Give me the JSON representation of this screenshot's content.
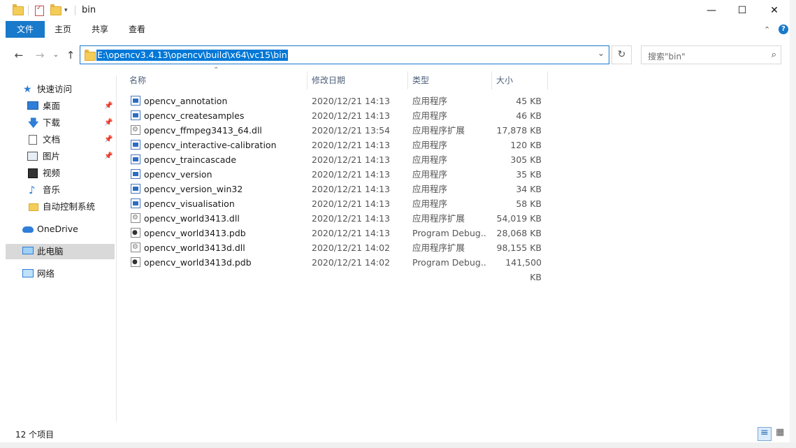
{
  "window": {
    "title": "bin",
    "controls": {
      "minimize": "—",
      "maximize": "☐",
      "close": "✕"
    }
  },
  "ribbon": {
    "tabs": [
      "文件",
      "主页",
      "共享",
      "查看"
    ]
  },
  "address": {
    "path": "E:\\opencv3.4.13\\opencv\\build\\x64\\vc15\\bin",
    "search_placeholder": "搜索\"bin\""
  },
  "nav": {
    "quick_access": "快速访问",
    "items": [
      {
        "label": "桌面",
        "icon": "desktop-icon",
        "pinned": true
      },
      {
        "label": "下载",
        "icon": "download-icon",
        "pinned": true
      },
      {
        "label": "文档",
        "icon": "documents-icon",
        "pinned": true
      },
      {
        "label": "图片",
        "icon": "pictures-icon",
        "pinned": true
      },
      {
        "label": "视频",
        "icon": "videos-icon",
        "pinned": false
      },
      {
        "label": "音乐",
        "icon": "music-icon",
        "pinned": false
      },
      {
        "label": "自动控制系统",
        "icon": "folder-icon",
        "pinned": false
      }
    ],
    "onedrive": "OneDrive",
    "this_pc": "此电脑",
    "network": "网络"
  },
  "columns": {
    "name": "名称",
    "date": "修改日期",
    "type": "类型",
    "size": "大小"
  },
  "files": [
    {
      "name": "opencv_annotation",
      "date": "2020/12/21 14:13",
      "type": "应用程序",
      "size": "45 KB",
      "kind": "exe"
    },
    {
      "name": "opencv_createsamples",
      "date": "2020/12/21 14:13",
      "type": "应用程序",
      "size": "46 KB",
      "kind": "exe"
    },
    {
      "name": "opencv_ffmpeg3413_64.dll",
      "date": "2020/12/21 13:54",
      "type": "应用程序扩展",
      "size": "17,878 KB",
      "kind": "dll"
    },
    {
      "name": "opencv_interactive-calibration",
      "date": "2020/12/21 14:13",
      "type": "应用程序",
      "size": "120 KB",
      "kind": "exe"
    },
    {
      "name": "opencv_traincascade",
      "date": "2020/12/21 14:13",
      "type": "应用程序",
      "size": "305 KB",
      "kind": "exe"
    },
    {
      "name": "opencv_version",
      "date": "2020/12/21 14:13",
      "type": "应用程序",
      "size": "35 KB",
      "kind": "exe"
    },
    {
      "name": "opencv_version_win32",
      "date": "2020/12/21 14:13",
      "type": "应用程序",
      "size": "34 KB",
      "kind": "exe"
    },
    {
      "name": "opencv_visualisation",
      "date": "2020/12/21 14:13",
      "type": "应用程序",
      "size": "58 KB",
      "kind": "exe"
    },
    {
      "name": "opencv_world3413.dll",
      "date": "2020/12/21 14:13",
      "type": "应用程序扩展",
      "size": "54,019 KB",
      "kind": "dll"
    },
    {
      "name": "opencv_world3413.pdb",
      "date": "2020/12/21 14:13",
      "type": "Program Debug...",
      "size": "28,068 KB",
      "kind": "pdb"
    },
    {
      "name": "opencv_world3413d.dll",
      "date": "2020/12/21 14:02",
      "type": "应用程序扩展",
      "size": "98,155 KB",
      "kind": "dll"
    },
    {
      "name": "opencv_world3413d.pdb",
      "date": "2020/12/21 14:02",
      "type": "Program Debug...",
      "size": "141,500 KB",
      "kind": "pdb"
    }
  ],
  "status": {
    "item_count": "12 个项目"
  }
}
